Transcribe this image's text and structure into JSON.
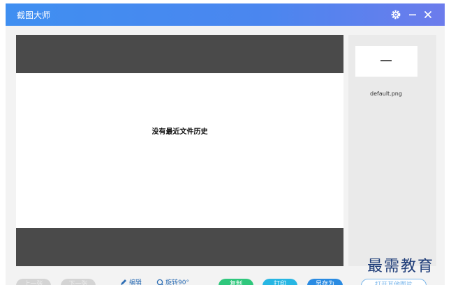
{
  "app": {
    "title": "截图大师"
  },
  "preview": {
    "empty_message": "没有最近文件历史"
  },
  "history": {
    "items": [
      {
        "filename": "default.png"
      }
    ]
  },
  "toolbar": {
    "prev_label": "上一张",
    "next_label": "下一张",
    "edit_label": "编辑",
    "rotate_label": "旋转90°",
    "copy_label": "复制",
    "print_label": "打印",
    "save_as_label": "另存为",
    "open_folder_label": "打开其他图片"
  },
  "watermark": {
    "text": "最需教育"
  },
  "colors": {
    "titlebar_start": "#3f8ff1",
    "titlebar_end": "#6c7cec",
    "copy_button": "#2fc77c",
    "print_button": "#27b6e3",
    "save_button": "#2a8be2"
  }
}
